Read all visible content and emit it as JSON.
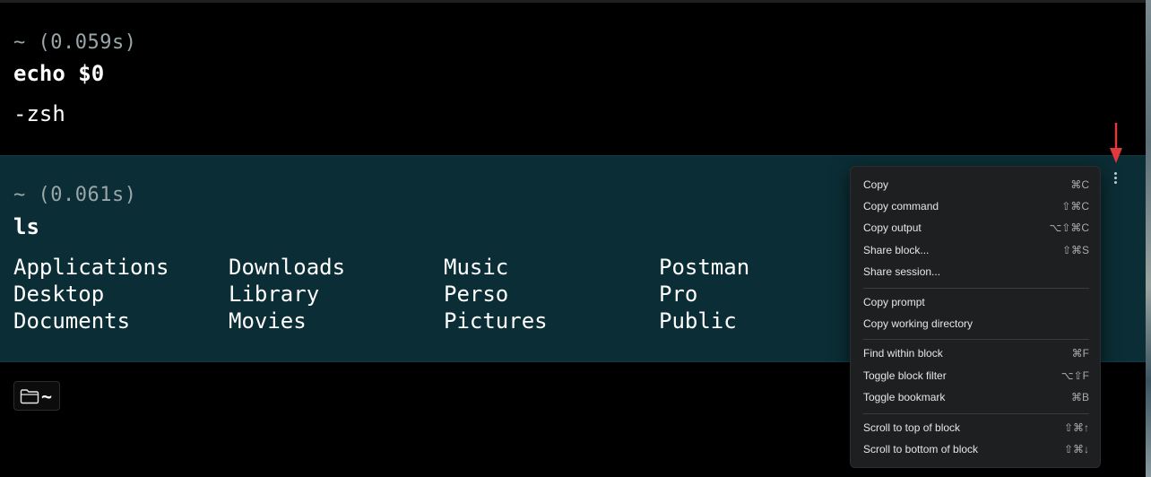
{
  "blocks": [
    {
      "prompt": "~ (0.059s)",
      "command": "echo $0",
      "output": "-zsh"
    },
    {
      "prompt": "~ (0.061s)",
      "command": "ls",
      "output_columns": [
        [
          "Applications",
          "Desktop",
          "Documents"
        ],
        [
          "Downloads",
          "Library",
          "Movies"
        ],
        [
          "Music",
          "Perso",
          "Pictures"
        ],
        [
          "Postman",
          "Pro",
          "Public"
        ]
      ]
    }
  ],
  "input": {
    "directory": "~",
    "icon": "folder-icon"
  },
  "block_menu": {
    "icon": "kebab-menu-icon",
    "items": [
      {
        "label": "Copy",
        "shortcut": "⌘C"
      },
      {
        "label": "Copy command",
        "shortcut": "⇧⌘C"
      },
      {
        "label": "Copy output",
        "shortcut": "⌥⇧⌘C"
      },
      {
        "label": "Share block...",
        "shortcut": "⇧⌘S"
      },
      {
        "label": "Share session...",
        "shortcut": ""
      },
      {
        "label": "Copy prompt",
        "shortcut": ""
      },
      {
        "label": "Copy working directory",
        "shortcut": ""
      },
      {
        "label": "Find within block",
        "shortcut": "⌘F"
      },
      {
        "label": "Toggle block filter",
        "shortcut": "⌥⇧F"
      },
      {
        "label": "Toggle bookmark",
        "shortcut": "⌘B"
      },
      {
        "label": "Scroll to top of block",
        "shortcut": "⇧⌘↑"
      },
      {
        "label": "Scroll to bottom of block",
        "shortcut": "⇧⌘↓"
      }
    ]
  },
  "colors": {
    "terminal_bg": "#000000",
    "selected_block_bg": "#0b2d35",
    "menu_bg": "#1e1f21",
    "annotation_arrow": "#e0393e"
  }
}
